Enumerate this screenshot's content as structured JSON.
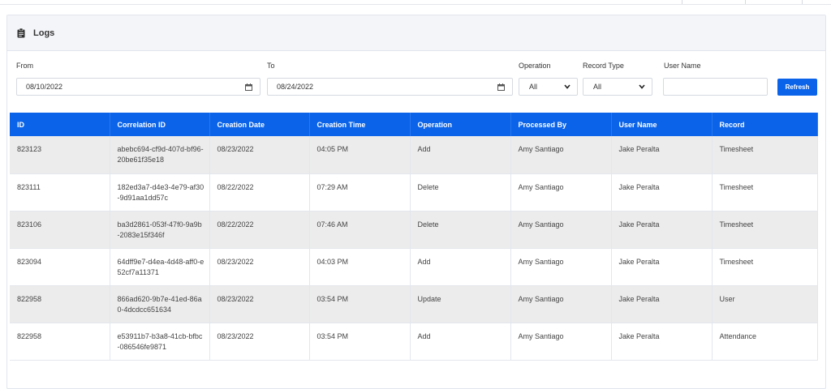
{
  "card": {
    "title": "Logs",
    "icon": "clipboard-icon"
  },
  "filters": {
    "from_label": "From",
    "from_value": "08/10/2022",
    "to_label": "To",
    "to_value": "08/24/2022",
    "operation_label": "Operation",
    "operation_value": "All",
    "record_type_label": "Record Type",
    "record_type_value": "All",
    "user_name_label": "User Name",
    "user_name_value": "",
    "refresh_label": "Refresh"
  },
  "table": {
    "columns": [
      "ID",
      "Correlation ID",
      "Creation Date",
      "Creation Time",
      "Operation",
      "Processed By",
      "User Name",
      "Record"
    ],
    "rows": [
      [
        "823123",
        "abebc694-cf9d-407d-bf96-20be61f35e18",
        "08/23/2022",
        "04:05 PM",
        "Add",
        "Amy Santiago",
        "Jake Peralta",
        "Timesheet"
      ],
      [
        "823111",
        "182ed3a7-d4e3-4e79-af30-9d91aa1dd57c",
        "08/22/2022",
        "07:29 AM",
        "Delete",
        "Amy Santiago",
        "Jake Peralta",
        "Timesheet"
      ],
      [
        "823106",
        "ba3d2861-053f-47f0-9a9b-2083e15f346f",
        "08/22/2022",
        "07:46 AM",
        "Delete",
        "Amy Santiago",
        "Jake Peralta",
        "Timesheet"
      ],
      [
        "823094",
        "64dff9e7-d4ea-4d48-aff0-e52cf7a11371",
        "08/23/2022",
        "04:03 PM",
        "Add",
        "Amy Santiago",
        "Jake Peralta",
        "Timesheet"
      ],
      [
        "822958",
        "866ad620-9b7e-41ed-86a0-4dcdcc651634",
        "08/23/2022",
        "03:54 PM",
        "Update",
        "Amy Santiago",
        "Jake Peralta",
        "User"
      ],
      [
        "822958",
        "e53911b7-b3a8-41cb-bfbc-086546fe9871",
        "08/23/2022",
        "03:54 PM",
        "Add",
        "Amy Santiago",
        "Jake Peralta",
        "Attendance"
      ]
    ]
  },
  "colors": {
    "accent": "#0a63e8",
    "header_bg": "#f3f5f9",
    "row_alt": "#ececec"
  }
}
